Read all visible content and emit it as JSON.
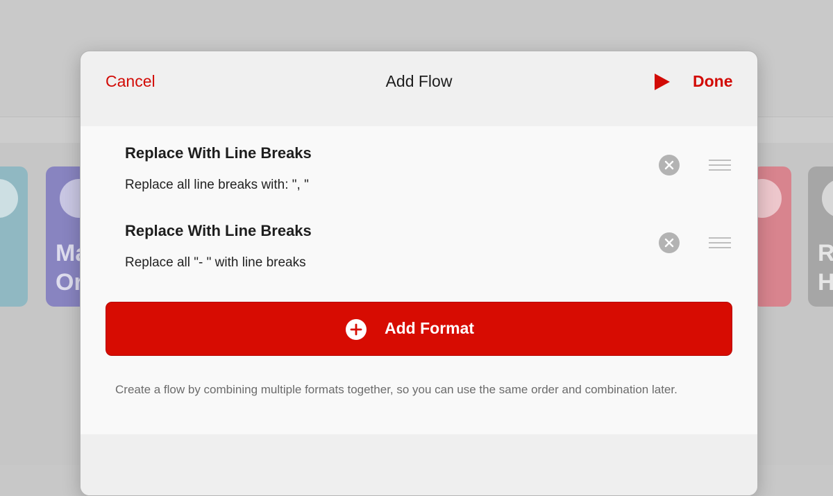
{
  "background": {
    "tiles": [
      {
        "text": ""
      },
      {
        "text": "Ma\nOr"
      },
      {
        "text": ""
      },
      {
        "text": "R\nH"
      }
    ]
  },
  "dialog": {
    "title": "Add Flow",
    "cancel_label": "Cancel",
    "done_label": "Done",
    "play_icon": "play-icon",
    "steps": [
      {
        "title": "Replace With Line Breaks",
        "description": "Replace all line breaks with: \", \""
      },
      {
        "title": "Replace With Line Breaks",
        "description": "Replace all \"- \" with line breaks"
      }
    ],
    "add_button_label": "Add Format",
    "add_icon": "plus-circle-icon",
    "footnote": "Create a flow by combining multiple formats together, so you can use the same order and combination later."
  },
  "colors": {
    "accent": "#d70c02",
    "text_accent": "#d20b06",
    "remove_icon_bg": "#b3b3b3",
    "handle": "#aaaaaa"
  }
}
